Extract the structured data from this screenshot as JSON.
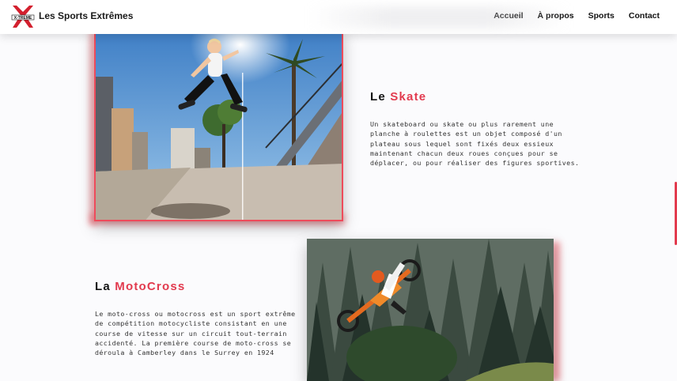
{
  "header": {
    "brand": "Les Sports Extrêmes",
    "logo_text": "X-TREME",
    "nav": [
      "Accueil",
      "À propos",
      "Sports",
      "Contact"
    ]
  },
  "sections": [
    {
      "title_prefix": "Le ",
      "title_accent": "Skate",
      "text": "Un skateboard ou skate ou plus rarement une planche à roulettes est un objet composé d'un plateau sous lequel sont fixés deux essieux maintenant chacun deux roues conçues pour se déplacer, ou pour réaliser des figures sportives."
    },
    {
      "title_prefix": "La ",
      "title_accent": "MotoCross",
      "text": "Le moto-cross ou motocross est un sport extrême de compétition motocycliste consistant en une course de vitesse sur un circuit tout-terrain accidenté. La première course de moto-cross se déroula à Camberley dans le Surrey en 1924"
    }
  ],
  "colors": {
    "accent": "#e23a4e",
    "header_bg": "#ffffff",
    "page_bg": "#fbfbfd"
  }
}
